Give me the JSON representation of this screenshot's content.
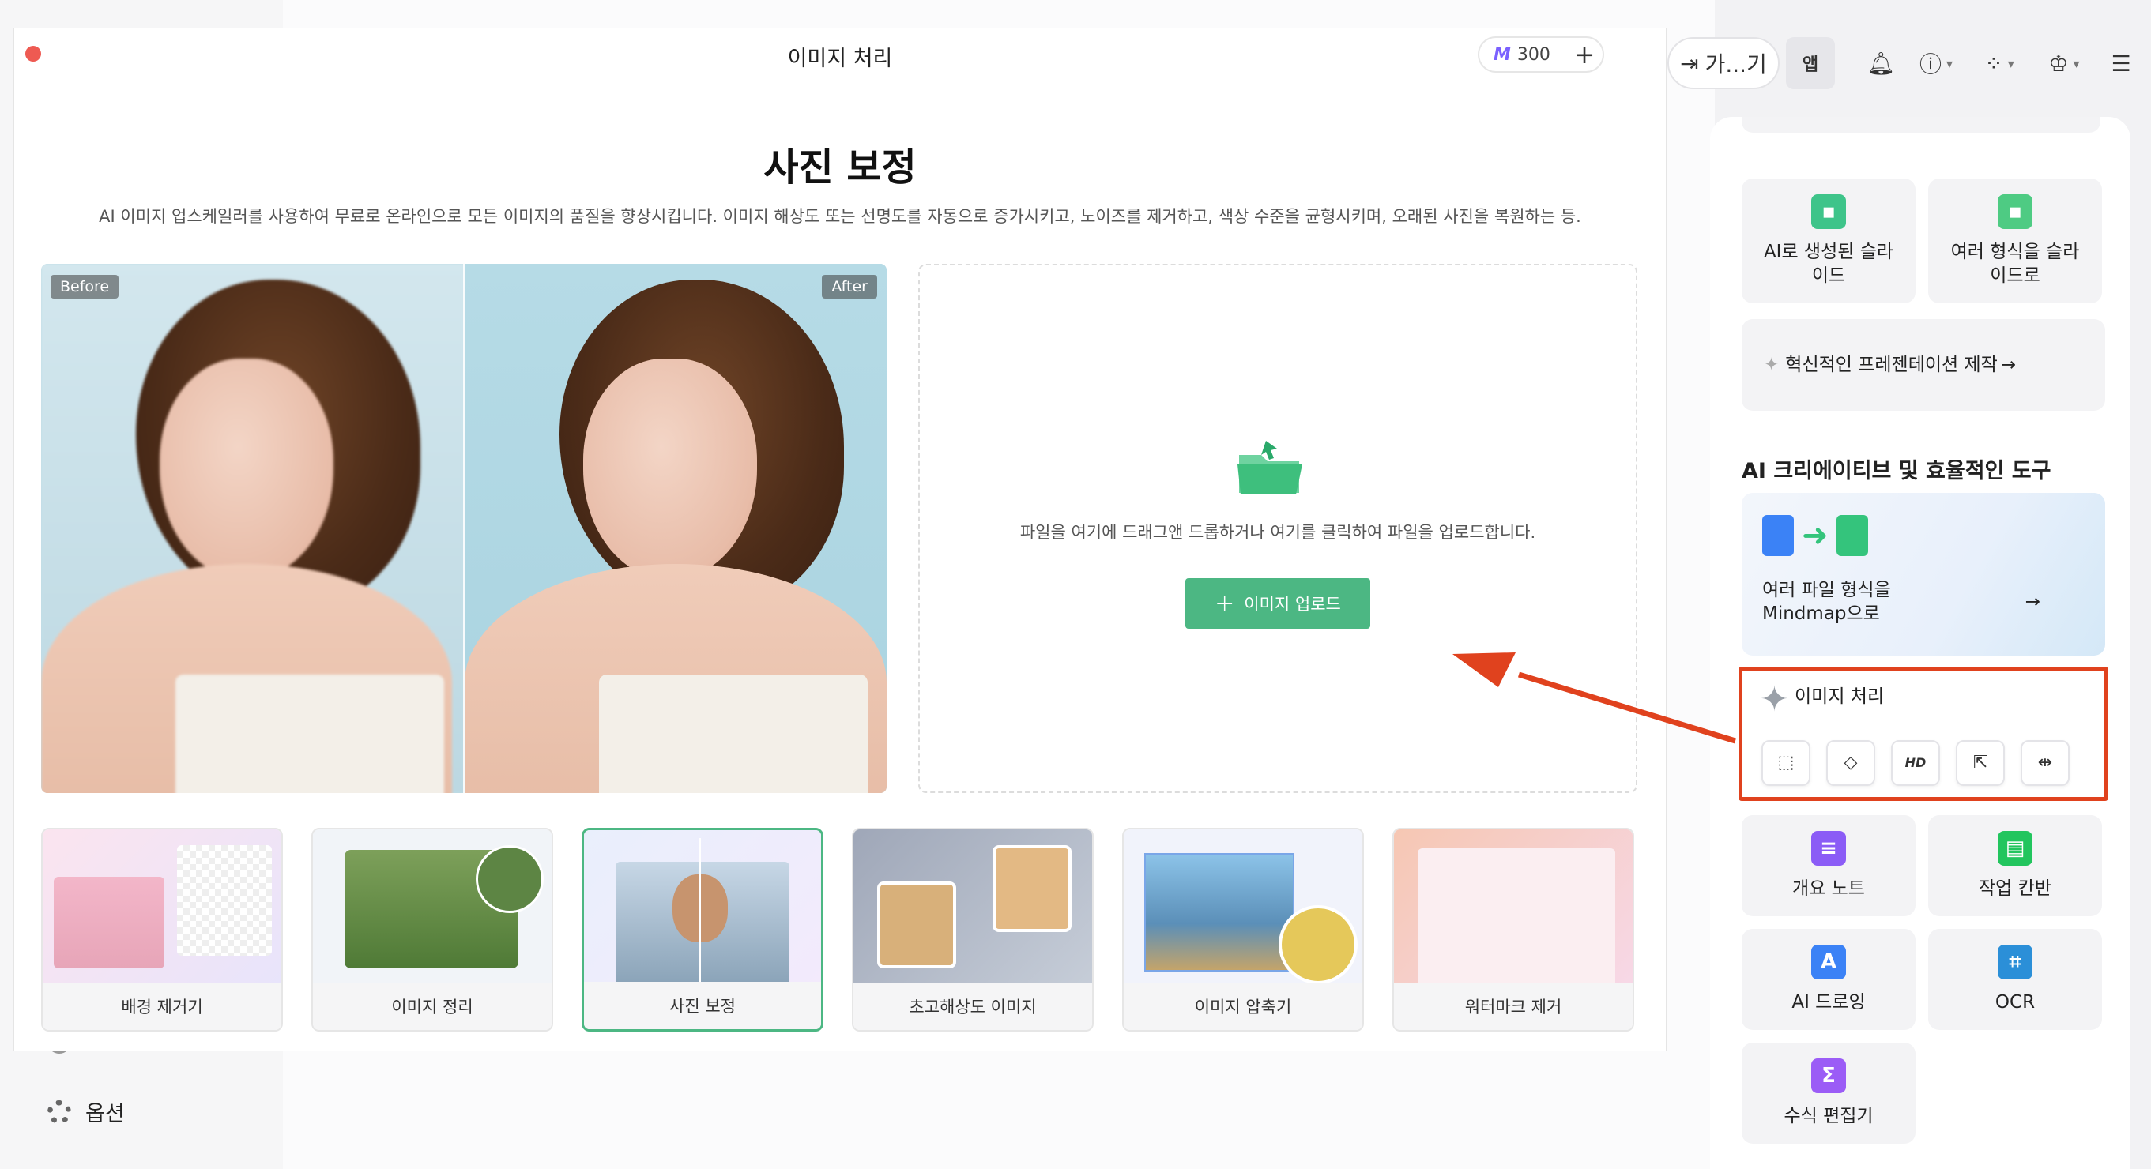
{
  "window": {
    "title": "이미지 처리",
    "credits": "300",
    "page_title": "사진 보정",
    "page_description": "AI 이미지 업스케일러를 사용하여 무료로 온라인으로 모든 이미지의 품질을 향상시킵니다. 이미지 해상도 또는 선명도를 자동으로 증가시키고, 노이즈를 제거하고, 색상 수준을 균형시키며, 오래된 사진을 복원하는 등.",
    "preview": {
      "before_tag": "Before",
      "after_tag": "After"
    },
    "drop_zone": {
      "text": "파일을 여기에 드래그앤 드롭하거나 여기를 클릭하여 파일을 업로드합니다.",
      "upload_button": "이미지 업로드"
    },
    "tools": [
      {
        "label": "배경 제거기"
      },
      {
        "label": "이미지 정리"
      },
      {
        "label": "사진 보정",
        "active": true
      },
      {
        "label": "초고해상도 이미지"
      },
      {
        "label": "이미지 압축기"
      },
      {
        "label": "워터마크 제거"
      }
    ]
  },
  "topbar": {
    "go_label": "가...기",
    "app_label": "앱",
    "icons": [
      "bell-icon",
      "help-icon",
      "apps-grid-icon",
      "shirt-icon",
      "outline-icon"
    ]
  },
  "sidebar": {
    "cards": {
      "ai_slides": "AI로 생성된 슬라이드",
      "formats_to_slides": "여러 형식을 슬라이드로",
      "innovative_presentation": "혁신적인 프레젠테이션 제작",
      "section_title": "AI 크리에이티브 및 효율적인 도구",
      "mindmap": "여러 파일 형식을 Mindmap으로",
      "image_processing": "이미지 처리",
      "outline_note": "개요 노트",
      "kanban": "작업 칸반",
      "ai_drawing": "AI 드로잉",
      "ocr": "OCR",
      "formula_editor": "수식 편집기"
    }
  },
  "left_sidebar": {
    "options_label": "옵션"
  },
  "colors": {
    "accent_green": "#4cb783",
    "highlight_red": "#e0421e"
  }
}
